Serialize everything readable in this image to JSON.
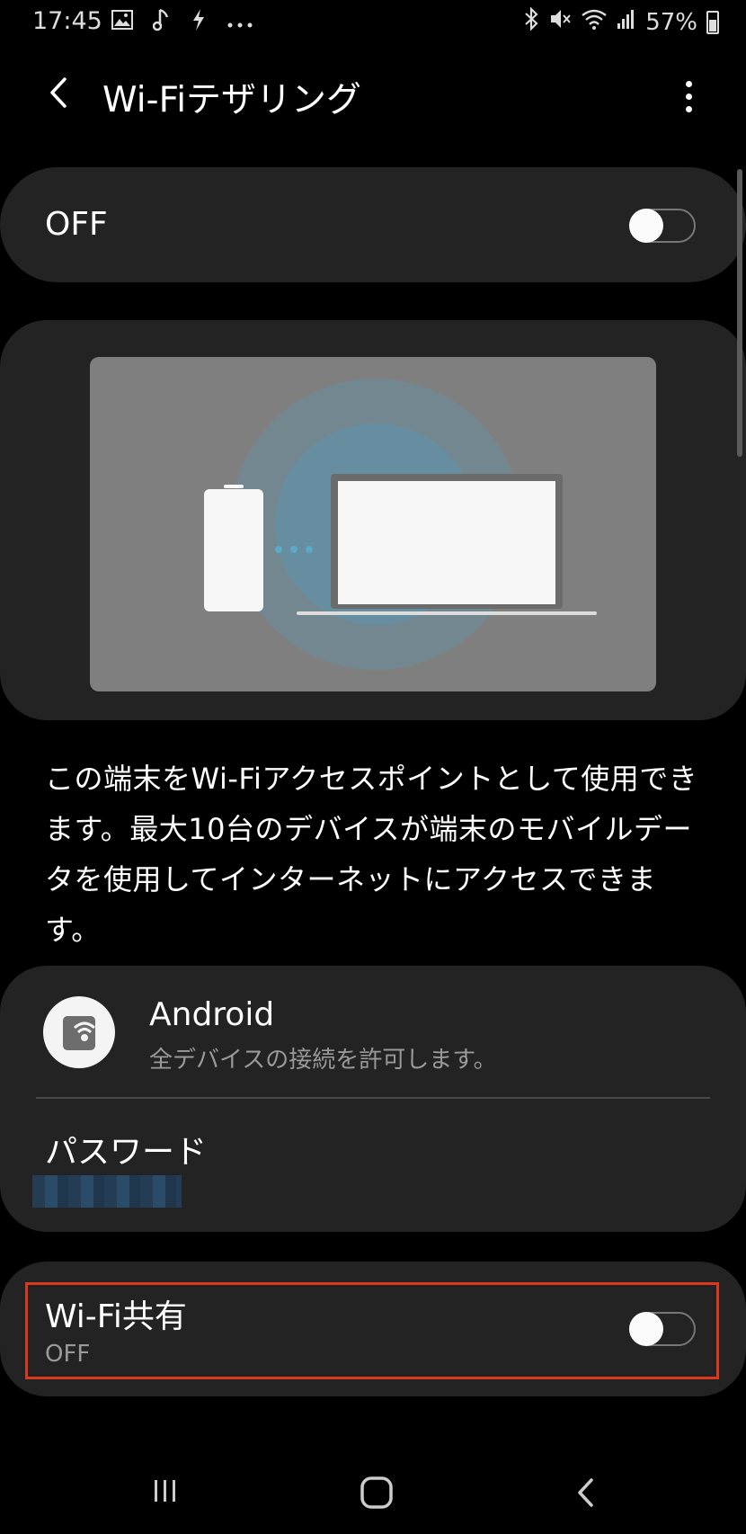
{
  "status_bar": {
    "time": "17:45",
    "battery": "57%",
    "left_icons": [
      "image-icon",
      "music-note-icon",
      "flash-icon",
      "more-dots-icon"
    ],
    "right_icons": [
      "bluetooth-icon",
      "mute-icon",
      "wifi-icon",
      "signal-icon",
      "battery-icon"
    ]
  },
  "header": {
    "title": "Wi-Fiテザリング"
  },
  "master_toggle": {
    "label": "OFF",
    "enabled": false
  },
  "description": "この端末をWi-Fiアクセスポイントとして使用できます。最大10台のデバイスが端末のモバイルデータを使用してインターネットにアクセスできます。",
  "network": {
    "name": "Android",
    "subtitle": "全デバイスの接続を許可します。",
    "password_label": "パスワード"
  },
  "wifi_sharing": {
    "label": "Wi-Fi共有",
    "status": "OFF",
    "enabled": false
  },
  "colors": {
    "background": "#000000",
    "card": "#232323",
    "highlight_border": "#d93a1e",
    "illustration_bg": "#7f7f7f",
    "accent_glow": "#5c93ad"
  }
}
